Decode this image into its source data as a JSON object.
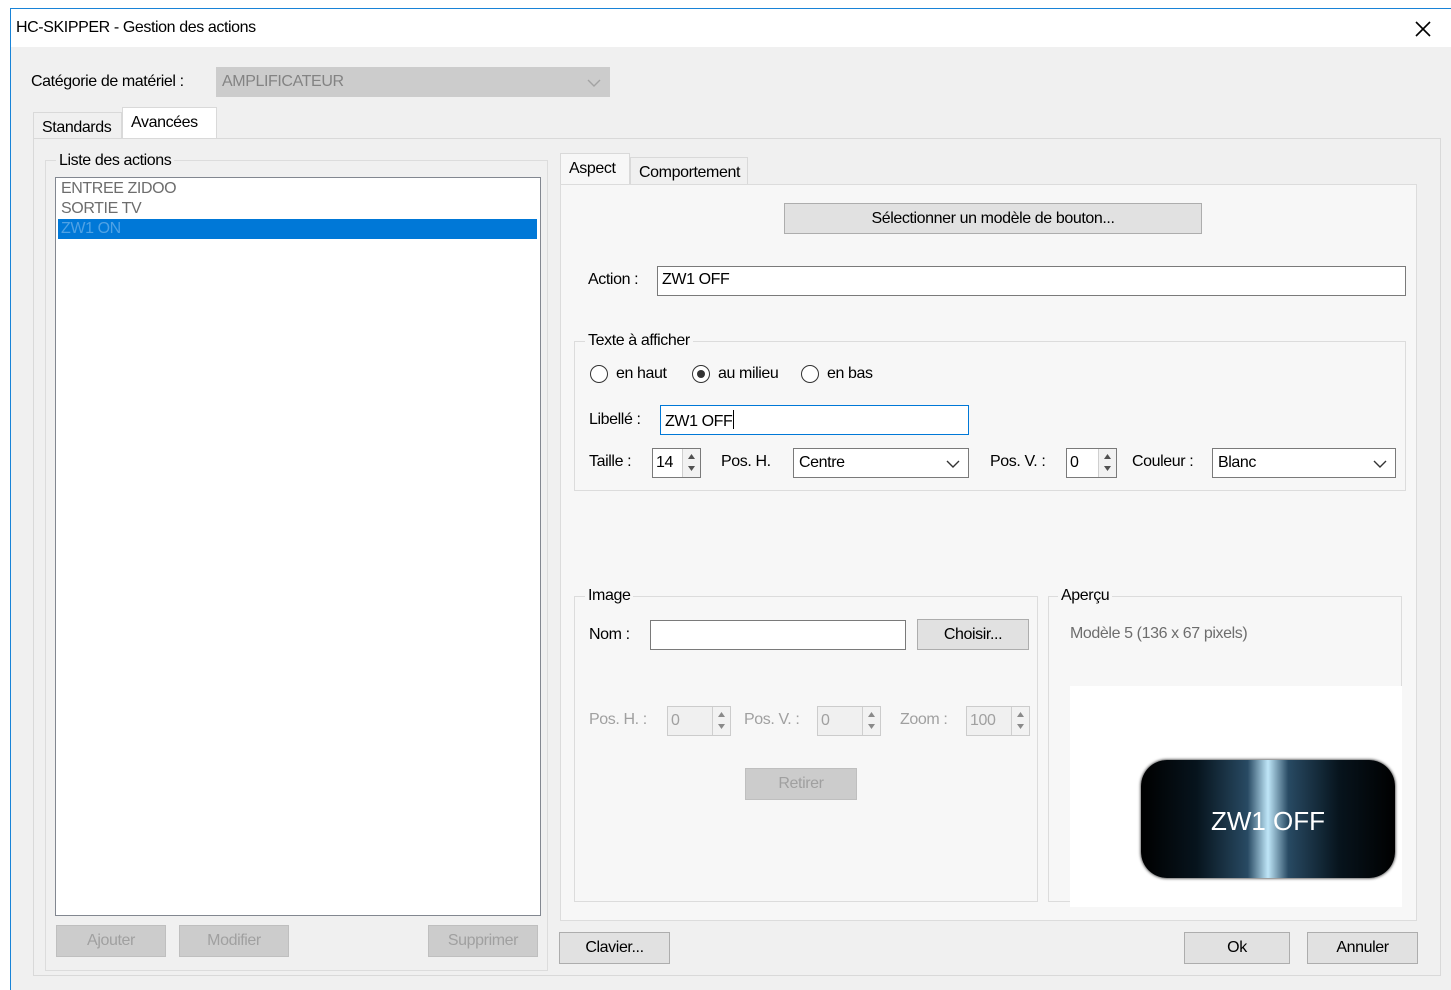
{
  "window": {
    "title": "HC-SKIPPER - Gestion des actions",
    "close_icon": "close-icon"
  },
  "category": {
    "label": "Catégorie de matériel :",
    "value": "AMPLIFICATEUR"
  },
  "main_tabs": [
    {
      "label": "Standards"
    },
    {
      "label": "Avancées",
      "selected": true
    }
  ],
  "actions_list": {
    "title": "Liste des actions",
    "items": [
      "ENTREE ZIDOO",
      "SORTIE TV",
      "ZW1 ON"
    ],
    "selected_index": 2,
    "buttons": {
      "add": "Ajouter",
      "modify": "Modifier",
      "delete": "Supprimer"
    }
  },
  "sub_tabs": [
    {
      "label": "Aspect",
      "selected": true
    },
    {
      "label": "Comportement"
    }
  ],
  "aspect": {
    "select_model_button": "Sélectionner un modèle de bouton...",
    "action_label": "Action :",
    "action_value": "ZW1 OFF",
    "text_group": {
      "title": "Texte à afficher",
      "positions": [
        {
          "label": "en haut"
        },
        {
          "label": "au milieu",
          "checked": true
        },
        {
          "label": "en bas"
        }
      ],
      "libelle_label": "Libellé :",
      "libelle_value": "ZW1 OFF",
      "size_label": "Taille :",
      "size_value": "14",
      "posh_label": "Pos. H.",
      "posh_value": "Centre",
      "posv_label": "Pos. V. :",
      "posv_value": "0",
      "color_label": "Couleur :",
      "color_value": "Blanc"
    },
    "image_group": {
      "title": "Image",
      "name_label": "Nom :",
      "name_value": "",
      "choose_button": "Choisir...",
      "posh_label": "Pos. H. :",
      "posh_value": "0",
      "posv_label": "Pos. V. :",
      "posv_value": "0",
      "zoom_label": "Zoom :",
      "zoom_value": "100",
      "remove_button": "Retirer"
    },
    "preview_group": {
      "title": "Aperçu",
      "model_info": "Modèle 5  (136 x 67 pixels)",
      "button_text": "ZW1 OFF"
    }
  },
  "footer": {
    "keyboard_button": "Clavier...",
    "ok_button": "Ok",
    "cancel_button": "Annuler"
  },
  "colors": {
    "accent": "#0078d7",
    "window_border": "#1883d7",
    "face": "#f0f0f0"
  }
}
